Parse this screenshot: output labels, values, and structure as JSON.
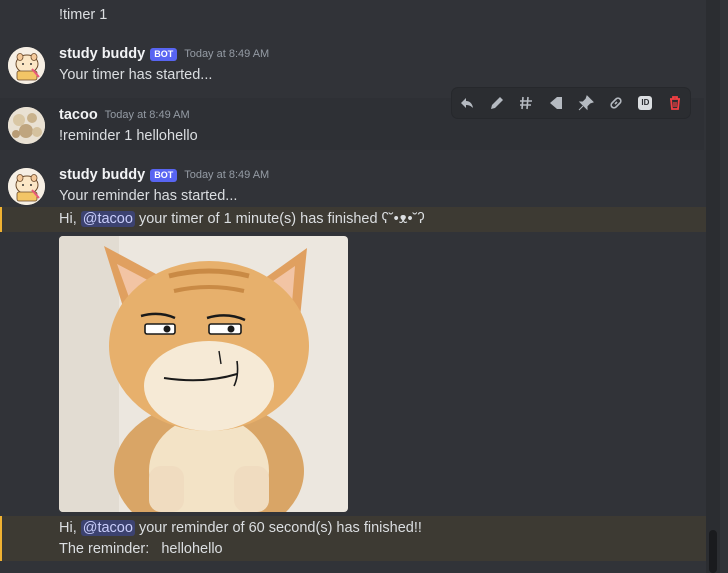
{
  "messages": {
    "m0": {
      "text": "!timer 1"
    },
    "m1": {
      "author": "study buddy",
      "badge": "BOT",
      "time": "Today at 8:49 AM",
      "text": "Your timer has started..."
    },
    "m2": {
      "author": "tacoo",
      "time": "Today at 8:49 AM",
      "text": "!reminder 1 hellohello"
    },
    "m3": {
      "author": "study buddy",
      "badge": "BOT",
      "time": "Today at 8:49 AM",
      "text": "Your reminder has started...",
      "line2_prefix": "Hi, ",
      "mention": "@tacoo",
      "line2_suffix": " your timer of  1 minute(s) has finished ʕ˘•ᴥ•˘ʔ",
      "line3_prefix": "Hi, ",
      "line3_suffix": " your reminder of 60 second(s) has finished!!",
      "line4": "The reminder:   hellohello"
    }
  },
  "toolbar": {
    "icons": [
      "reply-icon",
      "edit-icon",
      "thread-icon",
      "tag-icon",
      "pin-icon",
      "link-icon",
      "id-icon",
      "trash-icon"
    ],
    "id_label": "ID"
  },
  "colors": {
    "background": "#313338",
    "highlight": "#3d3a33",
    "mention": "#3c4270",
    "bot_badge": "#5865f2",
    "danger": "#f23f43"
  }
}
